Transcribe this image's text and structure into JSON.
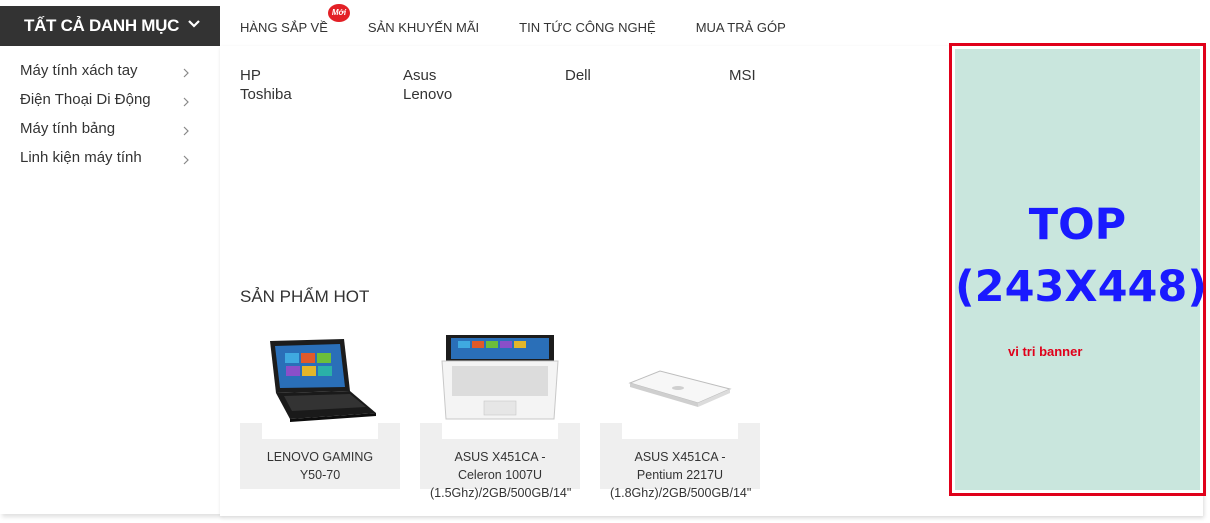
{
  "category_header": {
    "label": "TẤT CẢ DANH MỤC"
  },
  "topnav": {
    "items": [
      {
        "label": "HÀNG SẮP VỀ",
        "badge": "Mới"
      },
      {
        "label": "SẢN KHUYẾN MÃI"
      },
      {
        "label": "TIN TỨC CÔNG NGHỆ"
      },
      {
        "label": "MUA TRẢ GÓP"
      }
    ]
  },
  "sidebar": {
    "items": [
      {
        "label": "Máy tính xách tay"
      },
      {
        "label": "Điện Thoại Di Động"
      },
      {
        "label": "Máy tính bảng"
      },
      {
        "label": "Linh kiện máy tính"
      }
    ]
  },
  "brands": [
    "HP",
    "Asus",
    "Dell",
    "MSI",
    "Toshiba",
    "Lenovo"
  ],
  "hot_products": {
    "heading": "SẢN PHẨM HOT",
    "items": [
      {
        "line1": "LENOVO GAMING",
        "line2": "Y50-70",
        "line3": ""
      },
      {
        "line1": "ASUS X451CA -",
        "line2": "Celeron 1007U",
        "line3": "(1.5Ghz)/2GB/500GB/14\""
      },
      {
        "line1": "ASUS X451CA -",
        "line2": "Pentium 2217U",
        "line3": "(1.8Ghz)/2GB/500GB/14\""
      }
    ]
  },
  "banner": {
    "title_line1": "TOP",
    "title_line2": "(243X448)",
    "subtitle": "vi tri banner"
  },
  "colors": {
    "header_bg": "#333333",
    "badge": "#e32026",
    "banner_border": "#e0001a",
    "banner_fill": "#c9e6dd",
    "banner_title": "#1a1aff"
  }
}
